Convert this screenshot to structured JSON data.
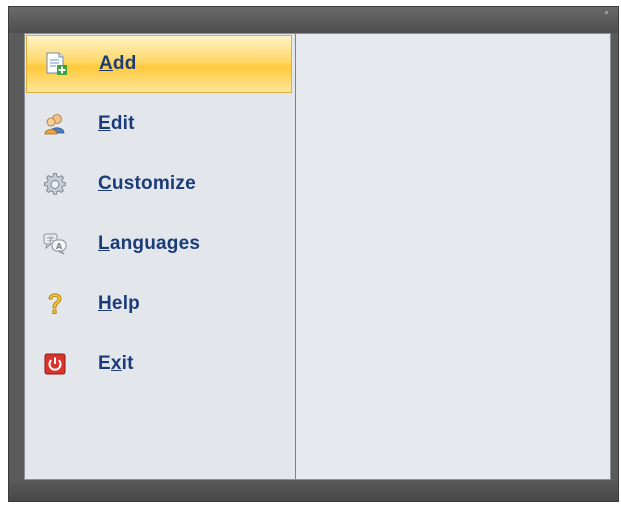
{
  "window": {
    "menu": {
      "items": [
        {
          "id": "add",
          "label_mnemonic": "A",
          "label_rest": "dd",
          "icon": "add-document-icon",
          "active": true
        },
        {
          "id": "edit",
          "label_mnemonic": "E",
          "label_rest": "dit",
          "icon": "users-edit-icon",
          "active": false
        },
        {
          "id": "customize",
          "label_mnemonic": "C",
          "label_rest": "ustomize",
          "icon": "gear-icon",
          "active": false
        },
        {
          "id": "languages",
          "label_mnemonic": "L",
          "label_rest": "anguages",
          "icon": "speech-bubbles-icon",
          "active": false
        },
        {
          "id": "help",
          "label_mnemonic": "H",
          "label_rest": "elp",
          "icon": "question-mark-icon",
          "active": false
        },
        {
          "id": "exit",
          "label_prefix": "E",
          "label_mnemonic": "x",
          "label_rest": "it",
          "icon": "power-icon",
          "active": false
        }
      ]
    },
    "colors": {
      "active_bg": "#ffd86a",
      "label_color": "#1b3c78",
      "frame": "#5b5b5b"
    }
  }
}
